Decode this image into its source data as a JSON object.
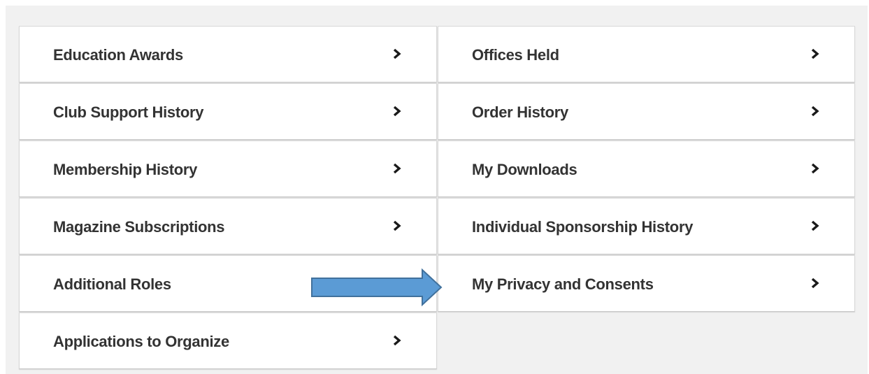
{
  "colors": {
    "panel_background": "#f1f1f1",
    "card_background": "#ffffff",
    "text": "#333333",
    "arrow_fill": "#5b9bd5",
    "arrow_stroke": "#41719c"
  },
  "left_column": {
    "items": [
      {
        "label": "Education Awards",
        "icon": "chevron-right-icon"
      },
      {
        "label": "Club Support History",
        "icon": "chevron-right-icon"
      },
      {
        "label": "Membership History",
        "icon": "chevron-right-icon"
      },
      {
        "label": "Magazine Subscriptions",
        "icon": "chevron-right-icon"
      },
      {
        "label": "Additional Roles",
        "icon": "chevron-right-icon"
      },
      {
        "label": "Applications to Organize",
        "icon": "chevron-right-icon"
      }
    ]
  },
  "right_column": {
    "items": [
      {
        "label": "Offices Held",
        "icon": "chevron-right-icon"
      },
      {
        "label": "Order History",
        "icon": "chevron-right-icon"
      },
      {
        "label": "My Downloads",
        "icon": "chevron-right-icon"
      },
      {
        "label": "Individual Sponsorship History",
        "icon": "chevron-right-icon"
      },
      {
        "label": "My Privacy and Consents",
        "icon": "chevron-right-icon"
      }
    ]
  },
  "annotation": {
    "icon": "right-arrow-annotation-icon",
    "points_to": "My Privacy and Consents"
  }
}
